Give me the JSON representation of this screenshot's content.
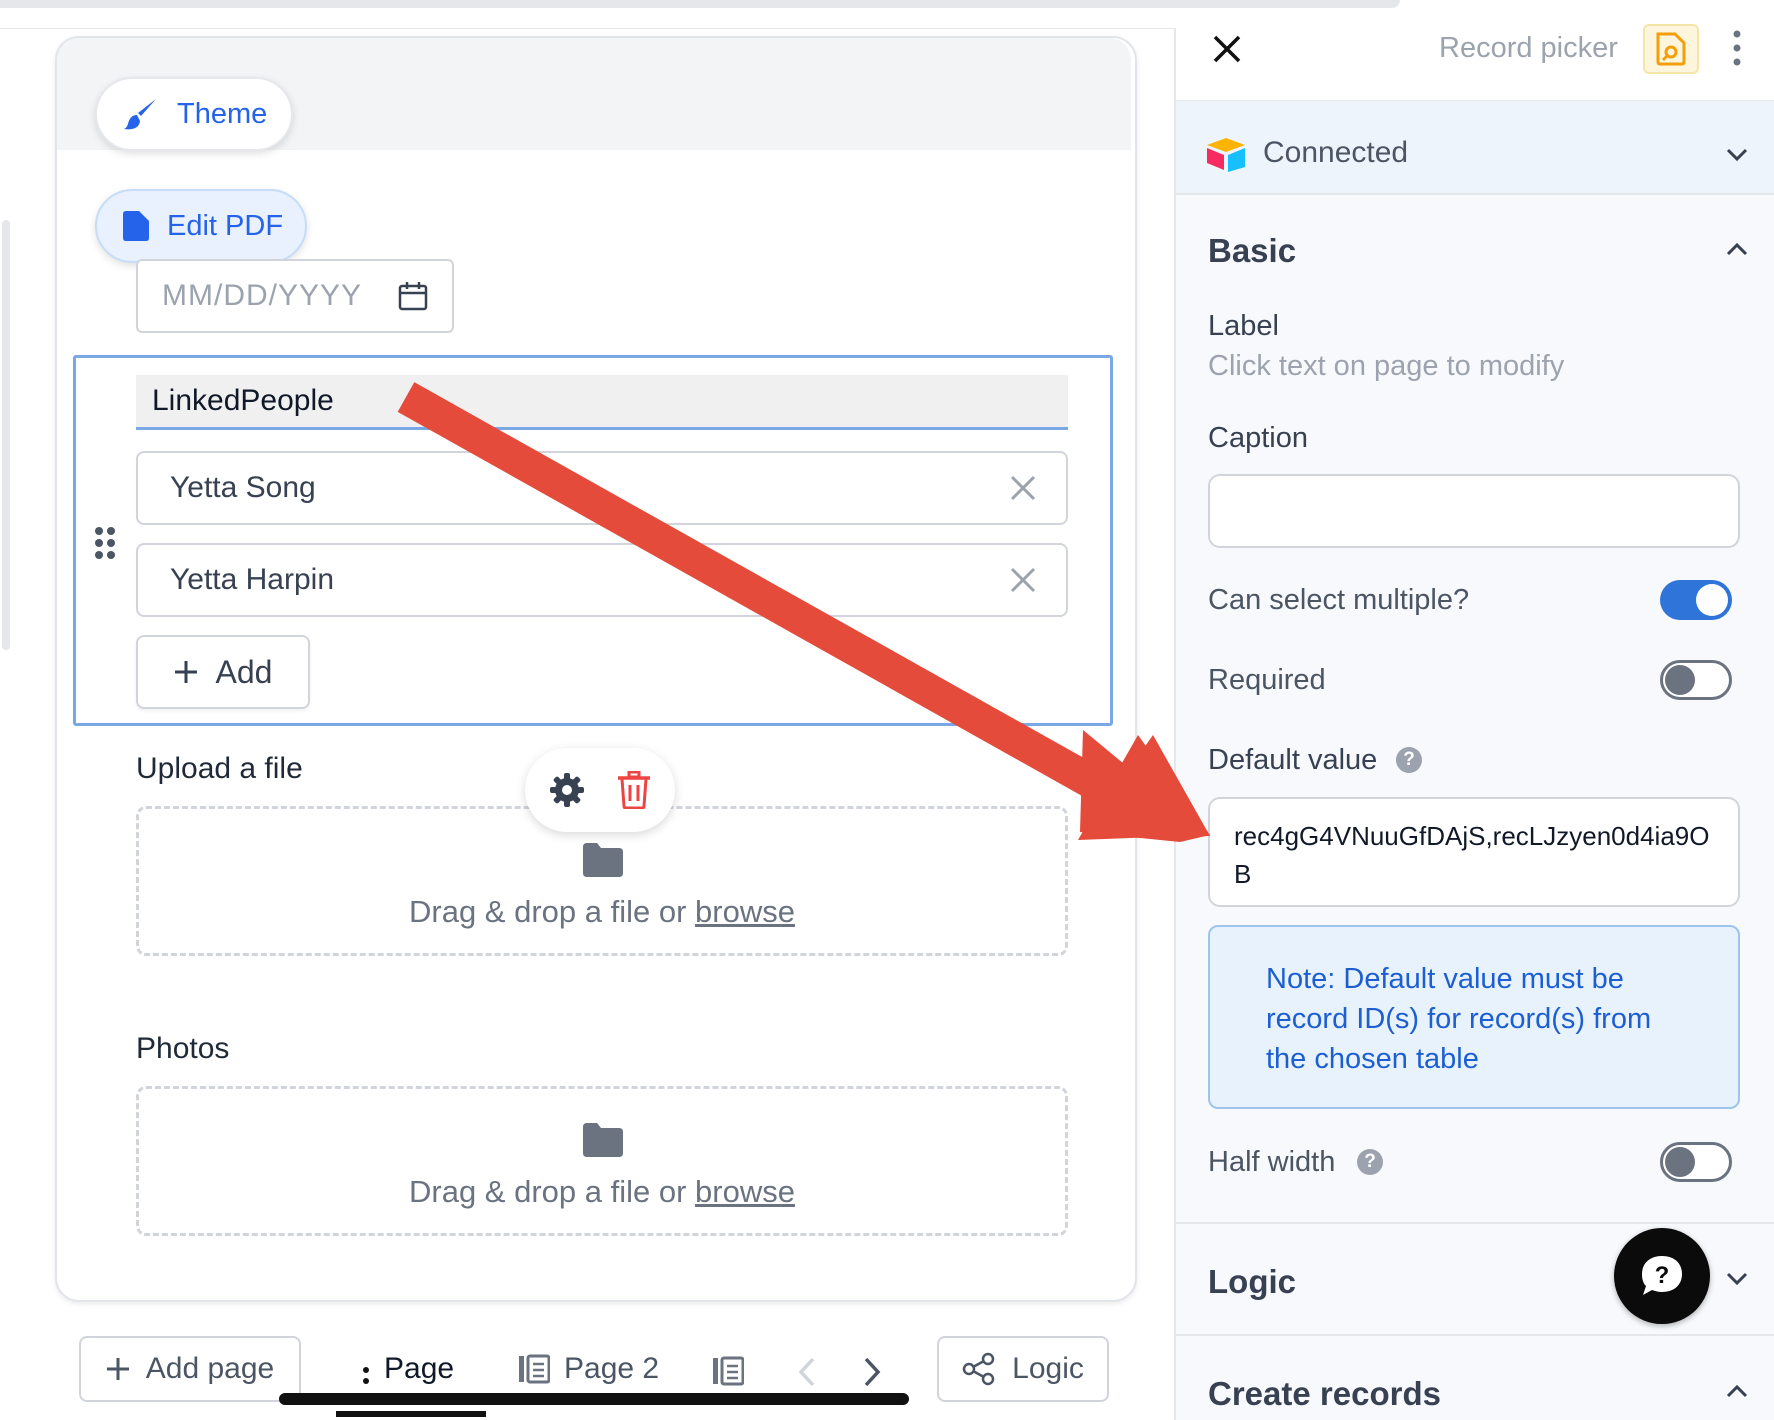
{
  "form": {
    "theme_label": "Theme",
    "edit_pdf_label": "Edit PDF",
    "date_placeholder": "MM/DD/YYYY",
    "linked_field": {
      "label": "LinkedPeople",
      "records": [
        "Yetta Song",
        "Yetta Harpin"
      ],
      "add_label": "Add"
    },
    "upload": {
      "label": "Upload a file",
      "drop_text": "Drag & drop a file or",
      "browse_text": "browse"
    },
    "photos": {
      "label": "Photos",
      "drop_text": "Drag & drop a file or",
      "browse_text": "browse"
    }
  },
  "bottom_bar": {
    "add_page_label": "Add page",
    "pages": [
      "Page",
      "Page 2"
    ],
    "logic_label": "Logic"
  },
  "panel": {
    "header_title": "Record picker",
    "connection_status": "Connected",
    "basic": {
      "title": "Basic",
      "label_title": "Label",
      "label_hint": "Click text on page to modify",
      "caption_title": "Caption",
      "caption_value": "",
      "can_select_multiple_label": "Can select multiple?",
      "can_select_multiple": true,
      "required_label": "Required",
      "required": false,
      "default_value_label": "Default value",
      "default_value": "rec4gG4VNuuGfDAjS,recLJzyen0d4ia9OB",
      "note": "Note: Default value must be record ID(s) for record(s) from the chosen table",
      "half_width_label": "Half width",
      "half_width": false
    },
    "logic_title": "Logic",
    "create_records_title": "Create records"
  },
  "colors": {
    "accent": "#2563eb",
    "selection_border": "#7aa7e6",
    "annotation_arrow": "#e44b3a",
    "delete": "#ef4444",
    "note_text": "#1d5fd1"
  }
}
